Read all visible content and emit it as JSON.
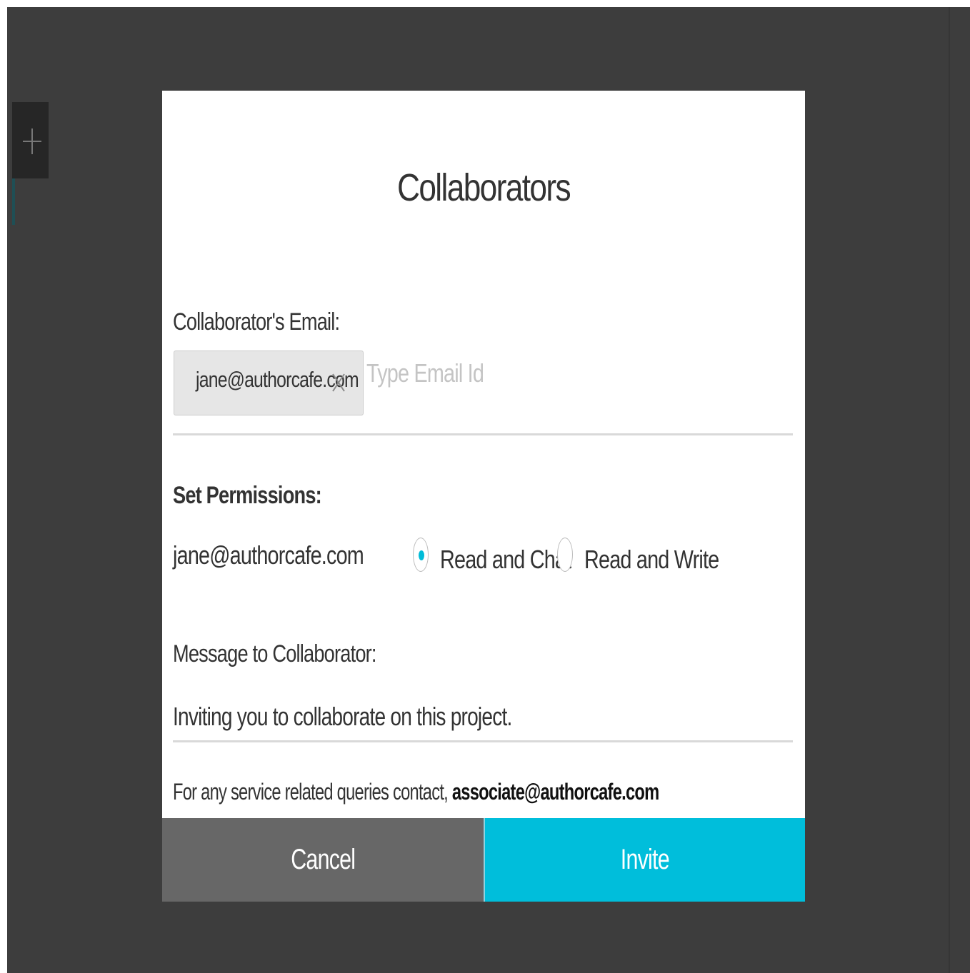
{
  "modal": {
    "title": "Collaborators",
    "email_label": "Collaborator's Email:",
    "email_chip": "jane@authorcafe.com",
    "email_input_placeholder": "Type Email Id",
    "permissions_label": "Set Permissions:",
    "permission_row": {
      "email": "jane@authorcafe.com",
      "options": [
        {
          "label": "Read and Chat",
          "selected": true
        },
        {
          "label": "Read and Write",
          "selected": false
        }
      ]
    },
    "message_label": "Message to Collaborator:",
    "message_text": "Inviting you to collaborate on this project.",
    "support_note_prefix": "For any service related queries contact,",
    "support_email": "associate@authorcafe.com",
    "cancel_label": "Cancel",
    "invite_label": "Invite"
  },
  "icons": {
    "side_tool": "plus-icon",
    "chip_remove": "close-icon"
  },
  "colors": {
    "backdrop": "#3d3d3d",
    "accent": "#00bedb",
    "cancel": "#676767"
  }
}
